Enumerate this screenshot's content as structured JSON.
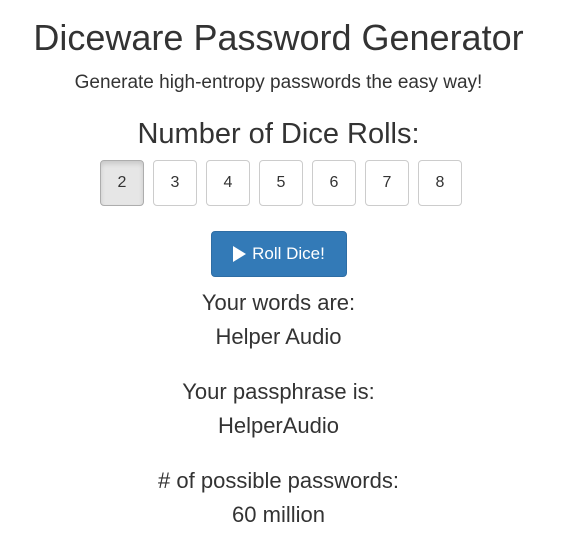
{
  "header": {
    "title": "Diceware Password Generator",
    "subtitle": "Generate high-entropy passwords the easy way!"
  },
  "dice": {
    "heading": "Number of Dice Rolls:",
    "options": [
      "2",
      "3",
      "4",
      "5",
      "6",
      "7",
      "8"
    ],
    "selected": "2"
  },
  "roll_button": {
    "label": "Roll Dice!",
    "icon": "play-icon",
    "color": "#337ab7"
  },
  "results": {
    "words_label": "Your words are:",
    "words_value": "Helper Audio",
    "passphrase_label": "Your passphrase is:",
    "passphrase_value": "HelperAudio",
    "possible_label": "# of possible passwords:",
    "possible_value": "60 million"
  }
}
